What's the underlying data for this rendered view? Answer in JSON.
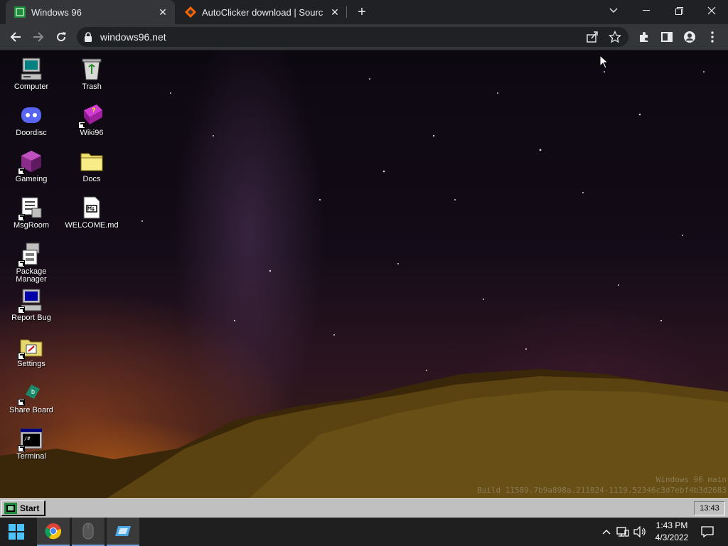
{
  "browser": {
    "tabs": [
      {
        "title": "Windows 96",
        "favicon": "windows96-favicon-icon",
        "active": true
      },
      {
        "title": "AutoClicker download | SourceFo",
        "favicon": "sourceforge-favicon-icon",
        "active": false
      }
    ],
    "new_tab_icon": "plus-icon",
    "url": "windows96.net"
  },
  "desktop": {
    "icons_left": [
      {
        "label": "Computer",
        "icon": "computer-icon",
        "shortcut": false
      },
      {
        "label": "Doordisc",
        "icon": "discord-icon",
        "shortcut": false
      },
      {
        "label": "Gameing",
        "icon": "game-cube-icon",
        "shortcut": true
      },
      {
        "label": "MsgRoom",
        "icon": "msgroom-icon",
        "shortcut": true
      },
      {
        "label": "Package Manager",
        "icon": "package-manager-icon",
        "shortcut": true
      },
      {
        "label": "Report Bug",
        "icon": "report-bug-icon",
        "shortcut": true
      },
      {
        "label": "Settings",
        "icon": "settings-folder-icon",
        "shortcut": true
      },
      {
        "label": "Share Board",
        "icon": "share-board-icon",
        "shortcut": true
      },
      {
        "label": "Terminal",
        "icon": "terminal-icon",
        "shortcut": true
      }
    ],
    "icons_right": [
      {
        "label": "Trash",
        "icon": "trash-icon",
        "shortcut": false
      },
      {
        "label": "Wiki96",
        "icon": "wiki-book-icon",
        "shortcut": true
      },
      {
        "label": "Docs",
        "icon": "folder-icon",
        "shortcut": false
      },
      {
        "label": "WELCOME.md",
        "icon": "markdown-file-icon",
        "shortcut": false
      }
    ],
    "watermark_line1": "Windows 96 main",
    "watermark_line2": "Build 11589.7b9a898a.211024-1119.52346c3d7ebf4b3d2683"
  },
  "win96_taskbar": {
    "start_label": "Start",
    "tray_time": "13:43"
  },
  "windows_taskbar": {
    "apps": [
      {
        "name": "chrome",
        "icon": "chrome-icon",
        "open": true
      },
      {
        "name": "mouse-app",
        "icon": "mouse-icon",
        "open": true
      },
      {
        "name": "app-window",
        "icon": "window-app-icon",
        "open": true
      }
    ],
    "time": "1:43 PM",
    "date": "4/3/2022"
  },
  "colors": {
    "tab_active": "#35363a",
    "tab_strip": "#202124",
    "win96_gray": "#c0c0c0",
    "taskbar_dark": "#1f1f1f"
  }
}
